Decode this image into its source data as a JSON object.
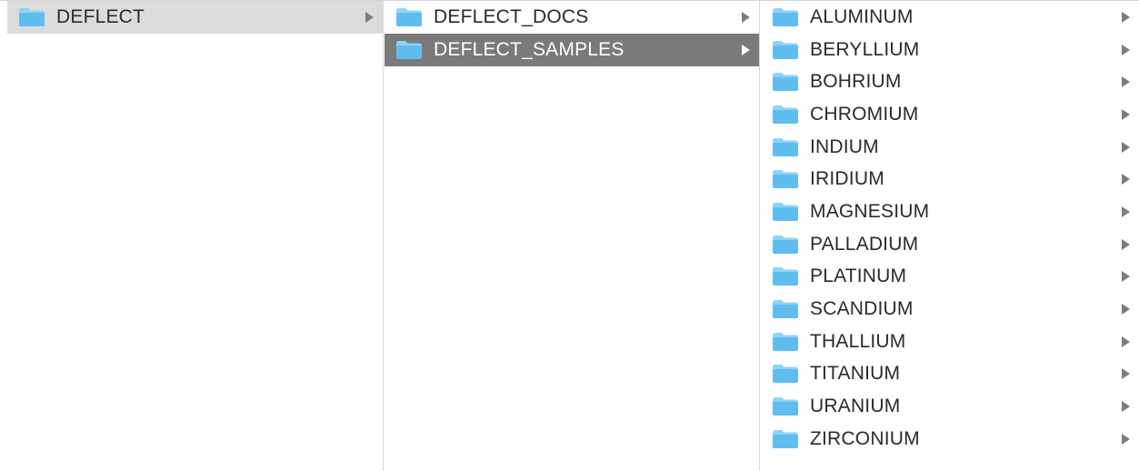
{
  "finder": {
    "columns": [
      {
        "items": [
          {
            "label": "DEFLECT",
            "state": "selected-inactive",
            "has_children": true
          }
        ]
      },
      {
        "items": [
          {
            "label": "DEFLECT_DOCS",
            "state": "normal",
            "has_children": true
          },
          {
            "label": "DEFLECT_SAMPLES",
            "state": "selected-active",
            "has_children": true
          }
        ]
      },
      {
        "items": [
          {
            "label": "ALUMINUM",
            "state": "normal",
            "has_children": true
          },
          {
            "label": "BERYLLIUM",
            "state": "normal",
            "has_children": true
          },
          {
            "label": "BOHRIUM",
            "state": "normal",
            "has_children": true
          },
          {
            "label": "CHROMIUM",
            "state": "normal",
            "has_children": true
          },
          {
            "label": "INDIUM",
            "state": "normal",
            "has_children": true
          },
          {
            "label": "IRIDIUM",
            "state": "normal",
            "has_children": true
          },
          {
            "label": "MAGNESIUM",
            "state": "normal",
            "has_children": true
          },
          {
            "label": "PALLADIUM",
            "state": "normal",
            "has_children": true
          },
          {
            "label": "PLATINUM",
            "state": "normal",
            "has_children": true
          },
          {
            "label": "SCANDIUM",
            "state": "normal",
            "has_children": true
          },
          {
            "label": "THALLIUM",
            "state": "normal",
            "has_children": true
          },
          {
            "label": "TITANIUM",
            "state": "normal",
            "has_children": true
          },
          {
            "label": "URANIUM",
            "state": "normal",
            "has_children": true
          },
          {
            "label": "ZIRCONIUM",
            "state": "normal",
            "has_children": true
          }
        ]
      }
    ],
    "icons": {
      "folder": "folder-icon",
      "disclosure": "chevron-right-icon"
    },
    "colors": {
      "folder_body": "#5fbdf0",
      "folder_tab": "#8fd3f7",
      "selected_active_bg": "#7a7a7a",
      "selected_inactive_bg": "#dcdcdc"
    }
  }
}
